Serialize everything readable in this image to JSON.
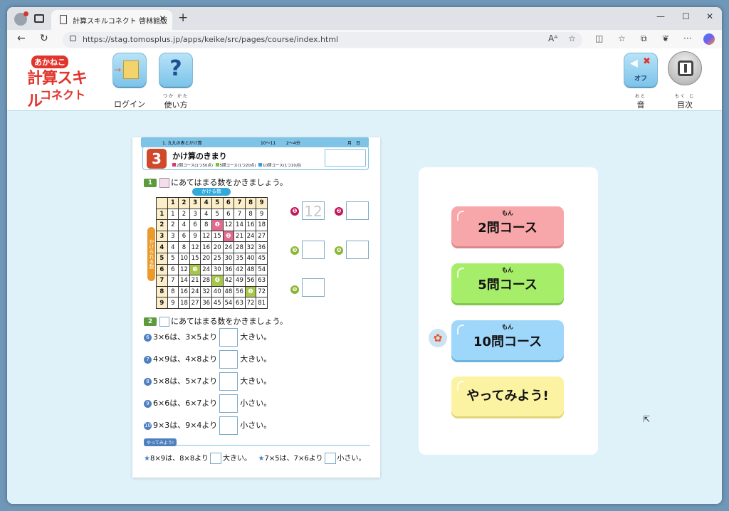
{
  "browser": {
    "tab_title": "計算スキルコネクト 啓林館版",
    "tab_close": "×",
    "new_tab": "+",
    "minimize": "—",
    "maximize": "☐",
    "close": "✕",
    "url": "https://stag.tomosplus.jp/apps/keike/src/pages/course/index.html",
    "back": "←",
    "reload": "↻"
  },
  "header": {
    "logo": {
      "line1": "あかねこ",
      "line2": "計算スキル",
      "line3": "コネクト"
    },
    "login_label": "ログイン",
    "help_label": "使い方",
    "help_ruby": "つか かた",
    "help_icon": "?",
    "sound_state": "オフ",
    "sound_label": "音",
    "sound_ruby": "おと",
    "toc_label": "目次",
    "toc_ruby": "もく じ"
  },
  "worksheet": {
    "head_left": "1. 九九の表とかけ算",
    "head_pages": "10〜11",
    "head_time": "2〜4分",
    "head_date_labels": "月　日",
    "number": "3",
    "title": "かけ算のきまり",
    "courses": [
      "2問コース(1つ50点)",
      "5問コース(1つ20点)",
      "10問コース(1つ10点)"
    ],
    "q1_number": "1",
    "q1_text": "にあてはまる数をかきましょう。",
    "kakeru_label": "かける数",
    "kakerareru_label": "かけられる数",
    "q2_number": "2",
    "q2_text": "にあてはまる数をかきましょう。",
    "answer1_hint": "12",
    "answer_labels": [
      "❶",
      "❷",
      "❸",
      "❹",
      "❺"
    ],
    "q2_rows": [
      {
        "num": "6",
        "text": "3×6は、3×5より",
        "suffix": "大きい。"
      },
      {
        "num": "7",
        "text": "4×9は、4×8より",
        "suffix": "大きい。"
      },
      {
        "num": "8",
        "text": "5×8は、5×7より",
        "suffix": "大きい。"
      },
      {
        "num": "9",
        "text": "6×6は、6×7より",
        "suffix": "小さい。"
      },
      {
        "num": "10",
        "text": "9×3は、9×4より",
        "suffix": "小さい。"
      }
    ],
    "yattemiyou_tag": "やってみよう!",
    "bottom_left": "8×9は、8×8より",
    "bottom_left_suffix": "大きい。",
    "bottom_right": "7×5は、7×6より",
    "bottom_right_suffix": "小さい。"
  },
  "courses_panel": {
    "ruby": "もん",
    "btn_2": "2問コース",
    "btn_5": "5問コース",
    "btn_10": "10問コース",
    "btn_try": "やってみよう!"
  }
}
